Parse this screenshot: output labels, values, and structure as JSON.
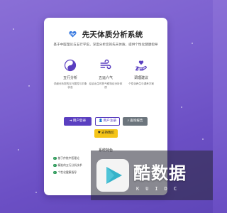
{
  "colors": {
    "accent": "#5a3fc0",
    "secondary": "#6c757d",
    "support": "#f5c518",
    "check": "#2e9a5a"
  },
  "header": {
    "icon": "heart-pulse-icon",
    "title": "先天体质分析系统",
    "subtitle": "基于中医理论与五行学说，深度分析您的先天体质，提供个性化健康指导"
  },
  "features": [
    {
      "icon": "yin-yang-icon",
      "name": "五行分析",
      "desc": "详细分析您的五行属性与平衡状态"
    },
    {
      "icon": "wind-icon",
      "name": "五运六气",
      "desc": "结合出生时的气候特征分析体质"
    },
    {
      "icon": "hand-heart-icon",
      "name": "调理建议",
      "desc": "个性化养生与调养方案"
    }
  ],
  "buttons": {
    "login": {
      "icon": "sign-in-icon",
      "label": "用户登录"
    },
    "register": {
      "icon": "user-plus-icon",
      "label": "用户注册"
    },
    "report": {
      "icon": "search-icon",
      "label": "查询报告"
    },
    "support": {
      "icon": "heart-icon",
      "label": "支持我们"
    }
  },
  "section": {
    "title": "系统特色",
    "items": [
      "基于传统中医理论",
      "精准的五行分析技术",
      "个性化健康指导"
    ]
  },
  "watermark": {
    "main": "酷数据",
    "sub": "KUIDC"
  }
}
